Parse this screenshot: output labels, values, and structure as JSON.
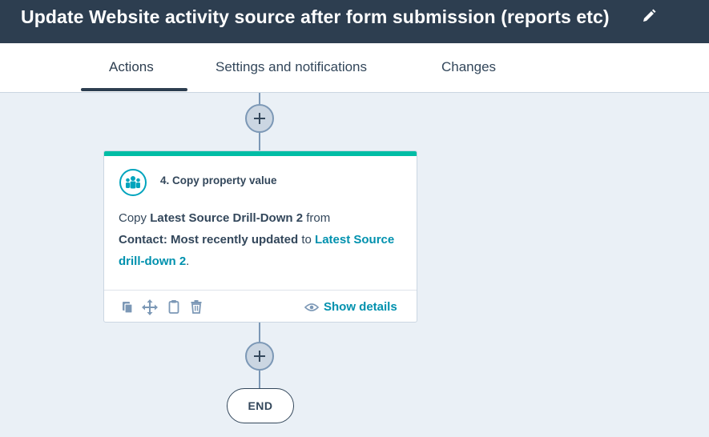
{
  "header": {
    "title": "Update Website activity source after form submission (reports etc)",
    "edit_icon": "pencil-icon"
  },
  "tabs": [
    {
      "label": "Actions",
      "active": true
    },
    {
      "label": "Settings and notifications",
      "active": false
    },
    {
      "label": "Changes",
      "active": false
    }
  ],
  "workflow": {
    "add_action_icon": "plus-icon",
    "card": {
      "title": "4. Copy property value",
      "icon": "people-group-icon",
      "body": {
        "t1": "Copy ",
        "source_property": "Latest Source Drill-Down 2",
        "t2": " from",
        "source_object": "Contact: Most recently updated",
        "t3": " to ",
        "target_property": "Latest Source drill-down 2",
        "t4": "."
      },
      "toolbar": {
        "copy_icon": "copy-icon",
        "move_icon": "move-icon",
        "clone_icon": "clipboard-icon",
        "delete_icon": "trash-icon"
      },
      "show_details_label": "Show details",
      "show_details_icon": "eye-icon"
    },
    "end_label": "END"
  },
  "colors": {
    "header_bg": "#2d3e50",
    "canvas_bg": "#eaf0f6",
    "accent_teal": "#00bda5",
    "link": "#0091ae"
  }
}
